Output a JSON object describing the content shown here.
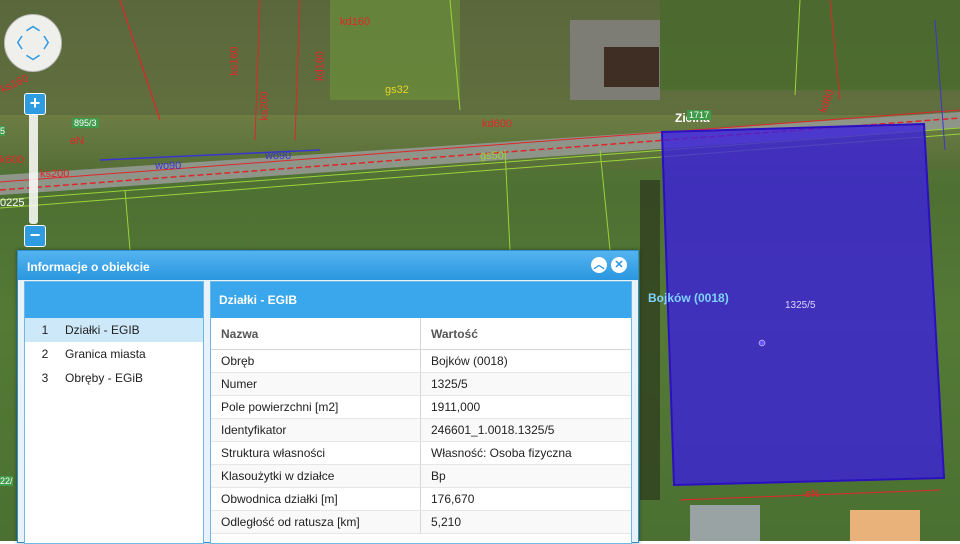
{
  "map": {
    "labels": {
      "street": "Zielna",
      "parcel_area": "Bojków (0018)",
      "parcel_number": "1325/5",
      "parcel_1717": "1717",
      "parcel_895": "895/3",
      "kd160": "kd160",
      "kd600": "kd600",
      "ks200": "ks200",
      "ks200b": "ks200",
      "ks160": "ks160",
      "ks160b": "ks160",
      "kd160v": "kd160",
      "kd60": "kd60",
      "wo90": "wo90",
      "wo90b": "wo90",
      "gs50": "gs50",
      "gs32": "gs32",
      "e": "e",
      "eN": "eN",
      "k600": "k600",
      "num_5": "5",
      "num_22": "22/",
      "num_0225": "0225"
    },
    "colors": {
      "parcel_fill": "#3b1ee0",
      "utility_red": "#e0262a",
      "boundary_green": "#9bd33a",
      "gas_yellow": "#e6d32a"
    }
  },
  "controls": {
    "pan_icon": "pan-arrows-icon",
    "zoom_in": "+",
    "zoom_out": "−"
  },
  "panel": {
    "title": "Informacje o obiekcie",
    "collapse_icon": "chevron-up-icon",
    "close_icon": "close-icon",
    "layers": [
      {
        "num": "1",
        "label": "Działki - EGIB"
      },
      {
        "num": "2",
        "label": "Granica miasta"
      },
      {
        "num": "3",
        "label": "Obręby - EGiB"
      }
    ],
    "details": {
      "title": "Działki - EGIB",
      "col_name": "Nazwa",
      "col_value": "Wartość",
      "rows": [
        {
          "name": "Obręb",
          "value": "Bojków (0018)"
        },
        {
          "name": "Numer",
          "value": "1325/5"
        },
        {
          "name": "Pole powierzchni [m2]",
          "value": "1911,000"
        },
        {
          "name": "Identyfikator",
          "value": "246601_1.0018.1325/5"
        },
        {
          "name": "Struktura własności",
          "value": "Własność: Osoba fizyczna"
        },
        {
          "name": "Klasoużytki w działce",
          "value": "Bp"
        },
        {
          "name": "Obwodnica działki [m]",
          "value": "176,670"
        },
        {
          "name": "Odległość od ratusza [km]",
          "value": "5,210"
        }
      ]
    }
  }
}
